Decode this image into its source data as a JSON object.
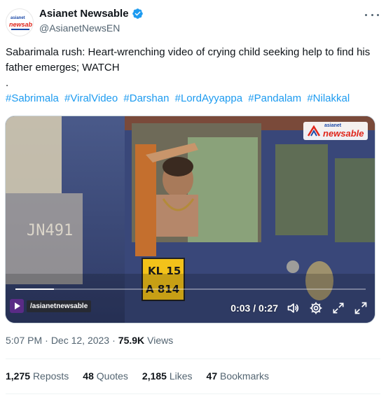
{
  "author": {
    "display_name": "Asianet Newsable",
    "handle": "@AsianetNewsEN",
    "avatar_logo_top": "asianet",
    "avatar_logo_bottom": "newsable",
    "verified": true
  },
  "tweet": {
    "text_line1": "Sabarimala rush: Heart-wrenching video of crying child seeking help to find his father emerges; WATCH",
    "text_dot": ".",
    "hashtags": [
      "#Sabrimala",
      "#ViralVideo",
      "#Darshan",
      "#LordAyyappa",
      "#Pandalam",
      "#Nilakkal"
    ]
  },
  "video": {
    "watermark_top": "asianet",
    "watermark_bottom": "newsable",
    "channel_label": "/asianetnewsable",
    "current_time": "0:03",
    "duration": "0:27",
    "time_display": "0:03 / 0:27",
    "progress": 0.11,
    "bus_number": "JN491",
    "plate_line1": "KL 15",
    "plate_line2": "A 814"
  },
  "meta": {
    "time": "5:07 PM",
    "separator": "·",
    "date": "Dec 12, 2023",
    "separator2": "·",
    "views_count": "75.9K",
    "views_label": "Views"
  },
  "stats": {
    "reposts_count": "1,275",
    "reposts_label": "Reposts",
    "quotes_count": "48",
    "quotes_label": "Quotes",
    "likes_count": "2,185",
    "likes_label": "Likes",
    "bookmarks_count": "47",
    "bookmarks_label": "Bookmarks"
  },
  "colors": {
    "accent": "#1d9bf0",
    "text_primary": "#0f1419",
    "text_secondary": "#536471",
    "brand_red": "#e0261b",
    "brand_blue": "#1d4aa8"
  },
  "icons": [
    "verified-badge-icon",
    "more-options-icon",
    "volume-icon",
    "settings-icon",
    "minimize-icon",
    "fullscreen-icon",
    "play-icon"
  ]
}
